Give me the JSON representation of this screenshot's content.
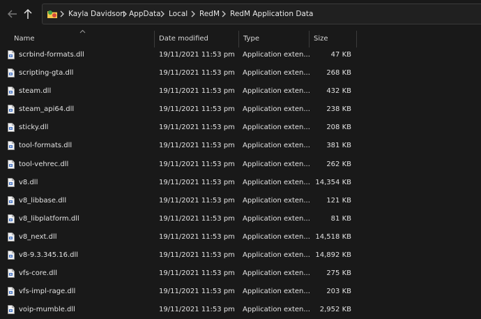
{
  "address_bar": {
    "breadcrumbs": [
      "Kayla Davidson",
      "AppData",
      "Local",
      "RedM",
      "RedM Application Data"
    ]
  },
  "columns": {
    "name": "Name",
    "date": "Date modified",
    "type": "Type",
    "size": "Size"
  },
  "files": [
    {
      "name": "scrbind-formats.dll",
      "date": "19/11/2021 11:53 pm",
      "type": "Application exten...",
      "size": "47 KB"
    },
    {
      "name": "scripting-gta.dll",
      "date": "19/11/2021 11:53 pm",
      "type": "Application exten...",
      "size": "268 KB"
    },
    {
      "name": "steam.dll",
      "date": "19/11/2021 11:53 pm",
      "type": "Application exten...",
      "size": "432 KB"
    },
    {
      "name": "steam_api64.dll",
      "date": "19/11/2021 11:53 pm",
      "type": "Application exten...",
      "size": "238 KB"
    },
    {
      "name": "sticky.dll",
      "date": "19/11/2021 11:53 pm",
      "type": "Application exten...",
      "size": "208 KB"
    },
    {
      "name": "tool-formats.dll",
      "date": "19/11/2021 11:53 pm",
      "type": "Application exten...",
      "size": "381 KB"
    },
    {
      "name": "tool-vehrec.dll",
      "date": "19/11/2021 11:53 pm",
      "type": "Application exten...",
      "size": "262 KB"
    },
    {
      "name": "v8.dll",
      "date": "19/11/2021 11:53 pm",
      "type": "Application exten...",
      "size": "14,354 KB"
    },
    {
      "name": "v8_libbase.dll",
      "date": "19/11/2021 11:53 pm",
      "type": "Application exten...",
      "size": "121 KB"
    },
    {
      "name": "v8_libplatform.dll",
      "date": "19/11/2021 11:53 pm",
      "type": "Application exten...",
      "size": "81 KB"
    },
    {
      "name": "v8_next.dll",
      "date": "19/11/2021 11:53 pm",
      "type": "Application exten...",
      "size": "14,518 KB"
    },
    {
      "name": "v8-9.3.345.16.dll",
      "date": "19/11/2021 11:53 pm",
      "type": "Application exten...",
      "size": "14,892 KB"
    },
    {
      "name": "vfs-core.dll",
      "date": "19/11/2021 11:53 pm",
      "type": "Application exten...",
      "size": "275 KB"
    },
    {
      "name": "vfs-impl-rage.dll",
      "date": "19/11/2021 11:53 pm",
      "type": "Application exten...",
      "size": "203 KB"
    },
    {
      "name": "voip-mumble.dll",
      "date": "19/11/2021 11:53 pm",
      "type": "Application exten...",
      "size": "2,952 KB"
    }
  ]
}
